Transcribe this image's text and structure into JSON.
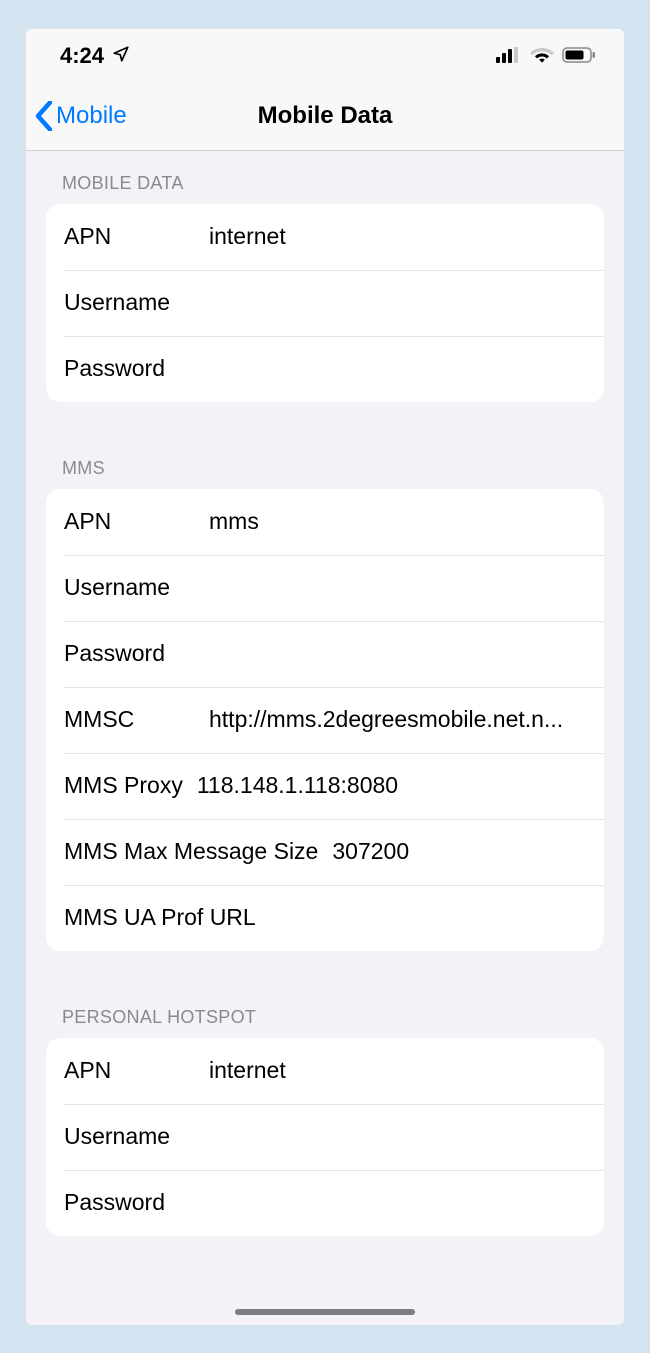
{
  "status": {
    "time": "4:24"
  },
  "nav": {
    "back_label": "Mobile",
    "title": "Mobile Data"
  },
  "sections": {
    "mobile_data": {
      "header": "MOBILE DATA",
      "apn_label": "APN",
      "apn_value": "internet",
      "username_label": "Username",
      "username_value": "",
      "password_label": "Password",
      "password_value": ""
    },
    "mms": {
      "header": "MMS",
      "apn_label": "APN",
      "apn_value": "mms",
      "username_label": "Username",
      "username_value": "",
      "password_label": "Password",
      "password_value": "",
      "mmsc_label": "MMSC",
      "mmsc_value": "http://mms.2degreesmobile.net.n...",
      "proxy_label": "MMS Proxy",
      "proxy_value": "118.148.1.118:8080",
      "maxsize_label": "MMS Max Message Size",
      "maxsize_value": "307200",
      "uaprof_label": "MMS UA Prof URL",
      "uaprof_value": ""
    },
    "hotspot": {
      "header": "PERSONAL HOTSPOT",
      "apn_label": "APN",
      "apn_value": "internet",
      "username_label": "Username",
      "username_value": "",
      "password_label": "Password",
      "password_value": ""
    }
  }
}
